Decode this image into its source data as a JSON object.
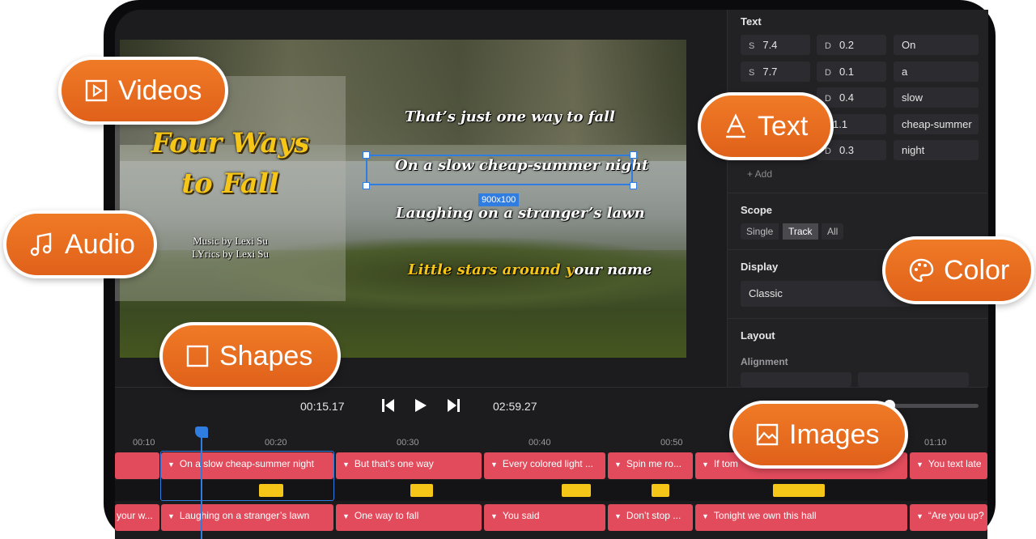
{
  "preview": {
    "title": "Four Ways to Fall",
    "title_line1": "Four Ways",
    "title_line2": "to Fall",
    "credit_music": "Music by Lexi Su",
    "credit_lyrics": "LYrics by Lexi Su",
    "lyrics": [
      "That’s just one way to fall",
      "On a slow cheap-summer night",
      "Laughing on a stranger’s lawn"
    ],
    "lyric4_hl": "Little stars around y",
    "lyric4_rest": "our name",
    "size_tag": "900x100"
  },
  "panel": {
    "text_header": "Text",
    "rows": [
      {
        "s_key": "S",
        "s": "7.4",
        "d_key": "D",
        "d": "0.2",
        "word": "On"
      },
      {
        "s_key": "S",
        "s": "7.7",
        "d_key": "D",
        "d": "0.1",
        "word": "a"
      },
      {
        "s_key": "",
        "s": "",
        "d_key": "D",
        "d": "0.4",
        "word": "slow"
      },
      {
        "s_key": "",
        "s": "",
        "d_key": "",
        "d": "1.1",
        "word": "cheap-summer"
      },
      {
        "s_key": "",
        "s": "",
        "d_key": "D",
        "d": "0.3",
        "word": "night"
      }
    ],
    "add_label": "+ Add",
    "scope_header": "Scope",
    "scope_options": [
      "Single",
      "Track",
      "All"
    ],
    "scope_selected": "Track",
    "display_header": "Display",
    "display_value": "Classic",
    "layout_header": "Layout",
    "alignment_label": "Alignment"
  },
  "playback": {
    "current_time": "00:15.17",
    "total_time": "02:59.27"
  },
  "timeline": {
    "ticks": [
      "00:10",
      "00:20",
      "00:30",
      "00:40",
      "00:50",
      "01:10"
    ],
    "track1": [
      "On a slow cheap-summer night",
      "But that’s one way",
      "Every colored light ...",
      "Spin me ro...",
      "If tom",
      "You text late"
    ],
    "track2": [
      "your w...",
      "Laughing on a stranger’s lawn",
      "One way to fall",
      "You said",
      "Don’t stop ...",
      "Tonight we own this hall",
      "“Are you up?"
    ]
  },
  "features": {
    "videos": "Videos",
    "audio": "Audio",
    "shapes": "Shapes",
    "text": "Text",
    "color": "Color",
    "images": "Images"
  },
  "colors": {
    "accent_orange": "#e86a1f",
    "clip_red": "#e14b5c",
    "selection_blue": "#2f7de1",
    "lyric_yellow": "#f5c518"
  }
}
